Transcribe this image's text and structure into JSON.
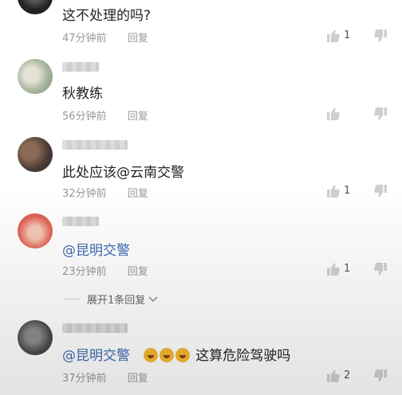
{
  "comments": [
    {
      "text": "这不处理的吗?",
      "time": "47分钟前",
      "reply": "回复",
      "likes": "1"
    },
    {
      "text": "秋教练",
      "time": "56分钟前",
      "reply": "回复",
      "likes": ""
    },
    {
      "text": "此处应该@云南交警",
      "time": "32分钟前",
      "reply": "回复",
      "likes": "1"
    },
    {
      "mention": "@昆明交警",
      "time": "23分钟前",
      "reply": "回复",
      "likes": "1"
    },
    {
      "mention": "@昆明交警",
      "text": "这算危险驾驶吗",
      "time": "37分钟前",
      "reply": "回复",
      "likes": "2"
    }
  ],
  "expand_replies": "展开1条回复",
  "icons": {
    "like": "thumbs-up-icon",
    "dislike": "thumbs-down-icon",
    "expand": "chevron-down-icon",
    "emoji": "laughing-emoji-icon"
  },
  "colors": {
    "mention": "#3d6ab3",
    "meta": "#999999",
    "text": "#222222"
  }
}
